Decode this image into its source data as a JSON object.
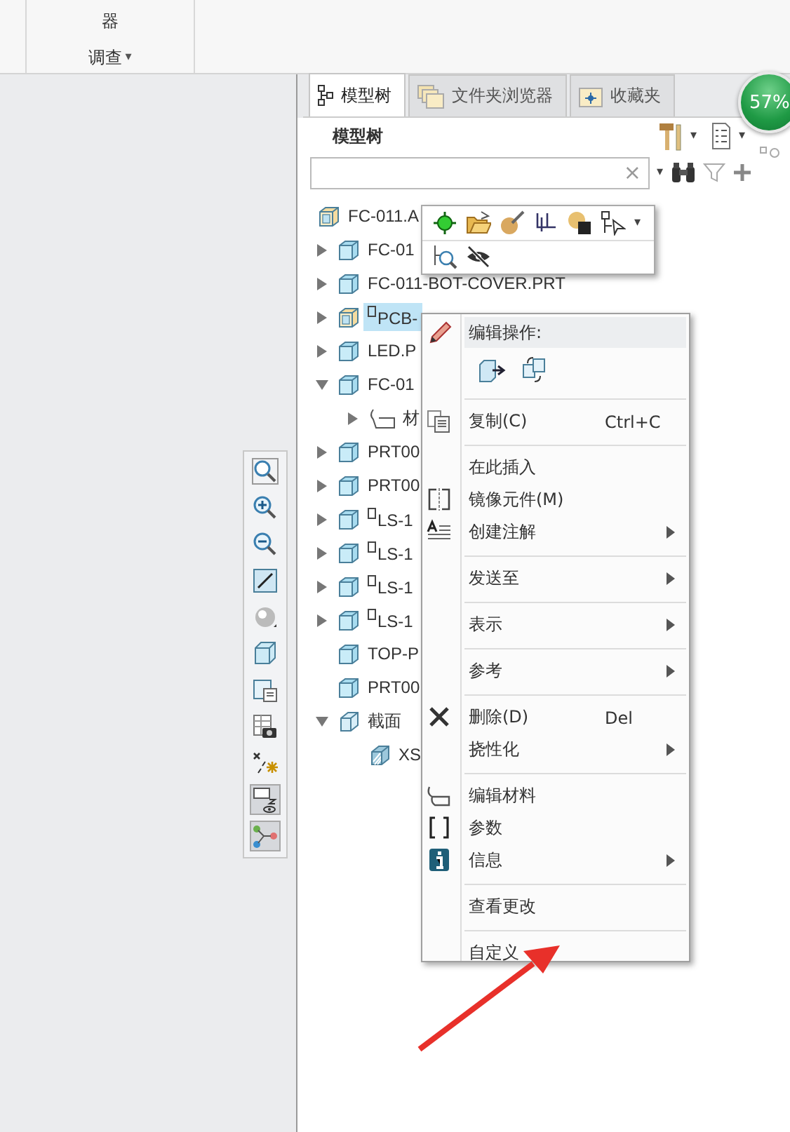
{
  "ribbon": {
    "group_label_tail": "器",
    "group_title": "调查",
    "group_caret": "▾"
  },
  "view_toolbar": [
    {
      "on": false
    },
    {
      "on": false
    },
    {
      "on": false
    },
    {
      "on": false
    },
    {
      "on": false
    },
    {
      "on": false
    },
    {
      "on": false
    },
    {
      "on": false
    },
    {
      "on": false
    },
    {
      "on": true
    },
    {
      "on": true
    }
  ],
  "tabs": [
    {
      "label": "模型树",
      "selected": true
    },
    {
      "label": "文件夹浏览器",
      "selected": false
    },
    {
      "label": "收藏夹",
      "selected": false
    }
  ],
  "progress_badge": {
    "text": "57%"
  },
  "panel": {
    "title": "模型树",
    "search": {
      "clear": "×"
    }
  },
  "tree": [
    {
      "label": "FC-011.A",
      "kind": "assembly",
      "selected": false,
      "marker": false,
      "children": [
        {
          "label": "FC-01",
          "kind": "part",
          "expanded": false,
          "selected": false,
          "marker": false
        },
        {
          "label": "FC-011-BOT-COVER.PRT",
          "kind": "part",
          "expanded": false,
          "selected": false,
          "marker": false
        },
        {
          "label": "PCB-",
          "kind": "assembly",
          "expanded": false,
          "selected": true,
          "marker": true
        },
        {
          "label": "LED.P",
          "kind": "part",
          "expanded": false,
          "selected": false,
          "marker": false
        },
        {
          "label": "FC-01",
          "kind": "part",
          "expanded": true,
          "selected": false,
          "marker": false,
          "children": [
            {
              "label": "材",
              "kind": "material",
              "expanded": false,
              "selected": false,
              "marker": false
            }
          ]
        },
        {
          "label": "PRT00",
          "kind": "part",
          "expanded": false,
          "selected": false,
          "marker": false
        },
        {
          "label": "PRT00",
          "kind": "part",
          "expanded": false,
          "selected": false,
          "marker": false
        },
        {
          "label": "LS-1",
          "kind": "part",
          "expanded": false,
          "selected": false,
          "marker": true
        },
        {
          "label": "LS-1",
          "kind": "part",
          "expanded": false,
          "selected": false,
          "marker": true
        },
        {
          "label": "LS-1",
          "kind": "part",
          "expanded": false,
          "selected": false,
          "marker": true
        },
        {
          "label": "LS-1",
          "kind": "part",
          "expanded": false,
          "selected": false,
          "marker": true
        },
        {
          "label": "TOP-P",
          "kind": "part",
          "selected": false,
          "marker": false
        },
        {
          "label": "PRT00",
          "kind": "part",
          "selected": false,
          "marker": false
        },
        {
          "label": "截面",
          "kind": "section",
          "expanded": true,
          "selected": false,
          "marker": false,
          "children": [
            {
              "label": "XS",
              "kind": "xsection",
              "selected": false,
              "marker": false
            }
          ]
        }
      ]
    }
  ],
  "mini_toolbar": {
    "caret": "▾"
  },
  "context_menu": [
    [
      {
        "kind": "header",
        "label": "编辑操作:"
      },
      {
        "kind": "icons"
      }
    ],
    [
      {
        "kind": "item",
        "label": "复制(C)",
        "shortcut": "Ctrl+C",
        "submenu": false
      }
    ],
    [
      {
        "kind": "item",
        "label": "在此插入",
        "submenu": false
      },
      {
        "kind": "item",
        "label": "镜像元件(M)",
        "submenu": false
      },
      {
        "kind": "item",
        "label": "创建注解",
        "submenu": true
      }
    ],
    [
      {
        "kind": "item",
        "label": "发送至",
        "submenu": true
      }
    ],
    [
      {
        "kind": "item",
        "label": "表示",
        "submenu": true
      }
    ],
    [
      {
        "kind": "item",
        "label": "参考",
        "submenu": true
      }
    ],
    [
      {
        "kind": "item",
        "label": "删除(D)",
        "shortcut": "Del",
        "submenu": false
      },
      {
        "kind": "item",
        "label": "挠性化",
        "submenu": true
      }
    ],
    [
      {
        "kind": "item",
        "label": "编辑材料",
        "submenu": false
      },
      {
        "kind": "item",
        "label": "参数",
        "submenu": false
      },
      {
        "kind": "item",
        "label": "信息",
        "submenu": true
      }
    ],
    [
      {
        "kind": "item",
        "label": "查看更改",
        "submenu": false
      }
    ],
    [
      {
        "kind": "item",
        "label": "自定义",
        "submenu": false
      }
    ]
  ],
  "annotation": {
    "kind": "arrow"
  }
}
